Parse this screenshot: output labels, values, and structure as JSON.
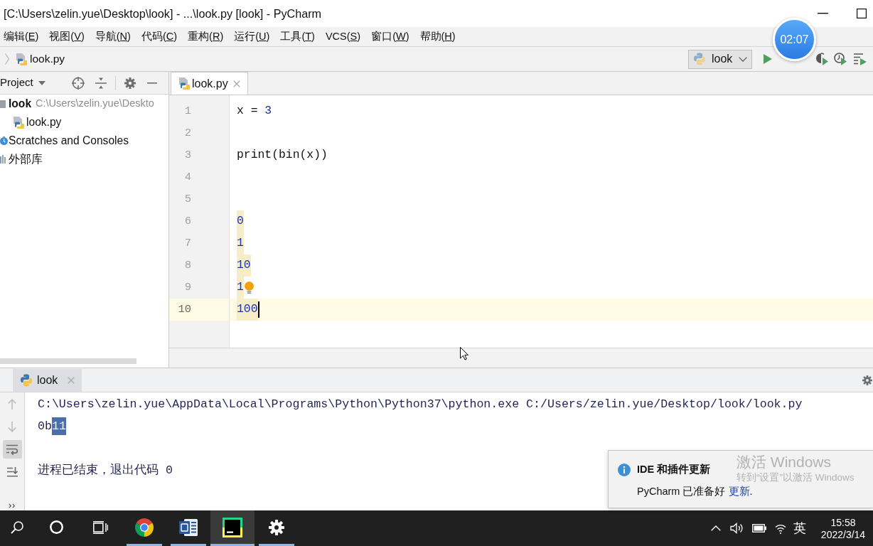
{
  "window": {
    "title": "[C:\\Users\\zelin.yue\\Desktop\\look] - ...\\look.py [look] - PyCharm"
  },
  "menu_bar": [
    {
      "before": "编辑(",
      "mnemonic": "E",
      "after": ")"
    },
    {
      "before": "视图(",
      "mnemonic": "V",
      "after": ")"
    },
    {
      "before": "导航(",
      "mnemonic": "N",
      "after": ")"
    },
    {
      "before": "代码(",
      "mnemonic": "C",
      "after": ")"
    },
    {
      "before": "重构(",
      "mnemonic": "R",
      "after": ")"
    },
    {
      "before": "运行(",
      "mnemonic": "U",
      "after": ")"
    },
    {
      "before": "工具(",
      "mnemonic": "T",
      "after": ")"
    },
    {
      "before": "VCS(",
      "mnemonic": "S",
      "after": ")"
    },
    {
      "before": "窗口(",
      "mnemonic": "W",
      "after": ")"
    },
    {
      "before": "帮助(",
      "mnemonic": "H",
      "after": ")"
    }
  ],
  "navigation_bar": {
    "breadcrumbs": [
      {
        "label": "look.py"
      }
    ],
    "run_configuration": {
      "label": "look"
    }
  },
  "project_panel": {
    "title": "Project",
    "tree": [
      {
        "kind": "project",
        "label": "look",
        "path": "C:\\Users\\zelin.yue\\Deskto",
        "children": [
          {
            "kind": "python_file",
            "label": "look.py"
          }
        ]
      },
      {
        "kind": "scratches",
        "label": "Scratches and Consoles"
      },
      {
        "kind": "library",
        "label": "外部库"
      }
    ]
  },
  "editor": {
    "tabs": [
      {
        "label": "look.py",
        "selected": true
      }
    ],
    "lines": [
      {
        "number": "1",
        "current": false,
        "warning": false,
        "tokens": [
          {
            "kind": "plain",
            "text": "x = "
          },
          {
            "kind": "number",
            "text": "3"
          }
        ]
      },
      {
        "number": "2",
        "current": false,
        "warning": false
      },
      {
        "number": "3",
        "current": false,
        "warning": false,
        "tokens": [
          {
            "kind": "plain",
            "text": "print(bin(x))"
          }
        ]
      },
      {
        "number": "4",
        "current": false,
        "warning": false
      },
      {
        "number": "5",
        "current": false,
        "warning": false
      },
      {
        "number": "6",
        "current": false,
        "warning": true,
        "tokens": [
          {
            "kind": "number",
            "text": "0"
          }
        ]
      },
      {
        "number": "7",
        "current": false,
        "warning": true,
        "tokens": [
          {
            "kind": "number",
            "text": "1"
          }
        ]
      },
      {
        "number": "8",
        "current": false,
        "warning": true,
        "tokens": [
          {
            "kind": "number",
            "text": "10"
          }
        ]
      },
      {
        "number": "9",
        "current": false,
        "warning": true,
        "tokens": [
          {
            "kind": "number",
            "text": "1"
          },
          {
            "kind": "bulb"
          }
        ]
      },
      {
        "number": "10",
        "current": true,
        "warning": true,
        "tokens": [
          {
            "kind": "number",
            "text": "100"
          },
          {
            "kind": "caret"
          }
        ]
      }
    ]
  },
  "run_panel": {
    "tabs": [
      {
        "label": "look",
        "selected": true
      }
    ],
    "toolbar": [
      {
        "kind": "up",
        "disabled": true,
        "selected": false
      },
      {
        "kind": "down",
        "disabled": true,
        "selected": false
      },
      {
        "kind": "soft_wrap",
        "disabled": false,
        "selected": true
      },
      {
        "kind": "scroll_to_end",
        "disabled": false,
        "selected": false
      }
    ],
    "console": [
      {
        "kind": "command",
        "segments": [
          {
            "text": "C:\\Users\\zelin.yue\\AppData\\Local\\Programs\\Python\\Python37\\python.exe C:/Users/zelin.yue/Desktop/look/look.py",
            "selected": false
          }
        ]
      },
      {
        "kind": "output",
        "segments": [
          {
            "text": "0b",
            "selected": false
          },
          {
            "text": "11",
            "selected": true
          }
        ]
      },
      {
        "kind": "exit",
        "segments": [
          {
            "text": "进程已结束，退出代码 0",
            "selected": false
          }
        ]
      }
    ]
  },
  "notification": {
    "title": "IDE 和插件更新",
    "message": {
      "text": "PyCharm 已准备好 ",
      "link": "更新",
      "after": "."
    }
  },
  "activation_watermark": {
    "title": "激活 Windows",
    "subtitle": "转到“设置”以激活 Windows"
  },
  "timer": {
    "text": "02:07"
  },
  "taskbar": {
    "items": [
      {
        "kind": "search",
        "running": false,
        "selected": false
      },
      {
        "kind": "assistant",
        "running": false,
        "selected": false
      },
      {
        "kind": "task_view",
        "running": false,
        "selected": false
      },
      {
        "kind": "browser",
        "running": true,
        "selected": false
      },
      {
        "kind": "word_processor",
        "running": true,
        "selected": false
      },
      {
        "kind": "ide",
        "running": true,
        "selected": true
      },
      {
        "kind": "settings",
        "running": true,
        "selected": false
      }
    ],
    "tray": {
      "input_method": "英",
      "time": "15:58",
      "date": "2022/3/14"
    }
  }
}
